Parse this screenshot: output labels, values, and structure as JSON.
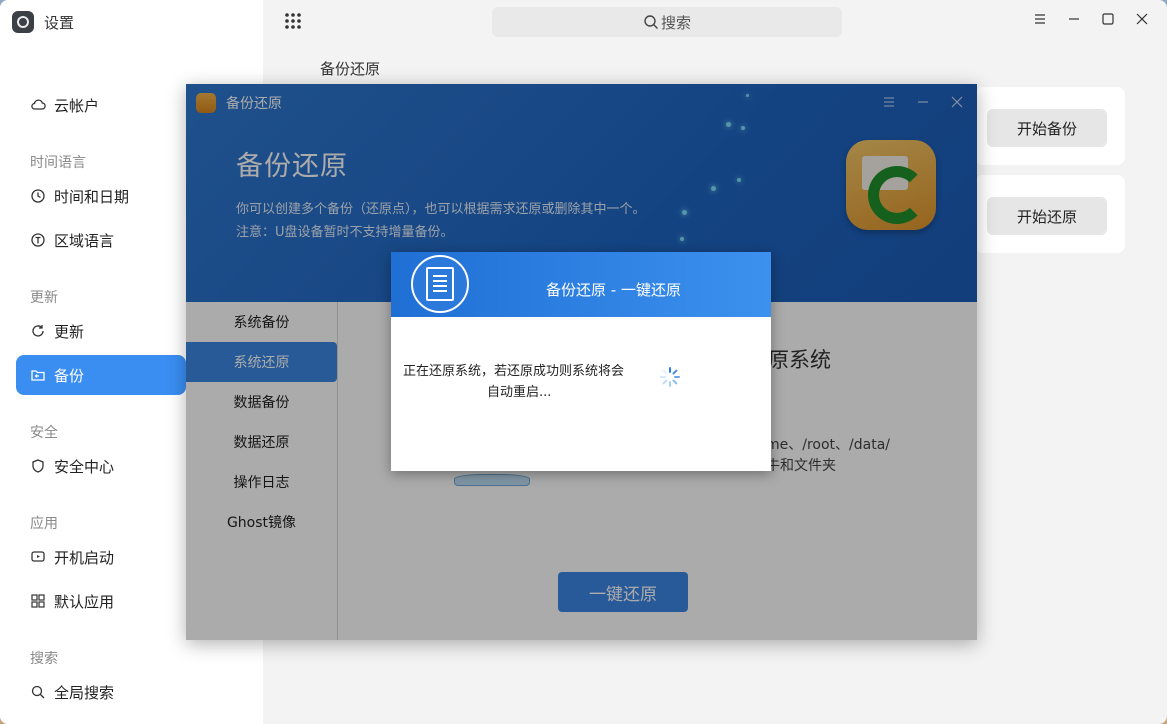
{
  "app": {
    "title": "设置"
  },
  "search": {
    "placeholder": "搜索"
  },
  "sidebar": {
    "groups": [
      {
        "title": "时间语言"
      },
      {
        "title": "更新"
      },
      {
        "title": "安全"
      },
      {
        "title": "应用"
      },
      {
        "title": "搜索"
      }
    ],
    "items": [
      {
        "label": "云帐户",
        "icon": "cloud-icon"
      },
      {
        "label": "时间和日期",
        "icon": "clock-icon"
      },
      {
        "label": "区域语言",
        "icon": "language-icon"
      },
      {
        "label": "更新",
        "icon": "update-icon"
      },
      {
        "label": "备份",
        "icon": "backup-icon",
        "active": true
      },
      {
        "label": "安全中心",
        "icon": "shield-icon"
      },
      {
        "label": "开机启动",
        "icon": "startup-icon"
      },
      {
        "label": "默认应用",
        "icon": "apps-grid-icon"
      },
      {
        "label": "全局搜索",
        "icon": "search-icon"
      }
    ]
  },
  "main": {
    "section_title": "备份还原",
    "start_backup": "开始备份",
    "start_restore": "开始还原"
  },
  "backup_window": {
    "title": "备份还原",
    "big_title": "备份还原",
    "desc1": "你可以创建多个备份（还原点），也可以根据需求还原或删除其中一个。",
    "desc2": "注意：U盘设备暂时不支持增量备份。",
    "menu": [
      "系统备份",
      "系统还原",
      "数据备份",
      "数据还原",
      "操作日志",
      "Ghost镜像"
    ],
    "right_title": "原系统",
    "right_text1": "me、/root、/data/",
    "right_text2": "牛和文件夹",
    "restore_button": "一键还原"
  },
  "modal": {
    "title": "备份还原 - 一键还原",
    "message_line1": "正在还原系统，若还原成功则系统将会",
    "message_line2": "自动重启..."
  },
  "colors": {
    "accent": "#3a8ef2",
    "header_blue": "#1f65c2",
    "modal_blue": "#3c91ee"
  }
}
